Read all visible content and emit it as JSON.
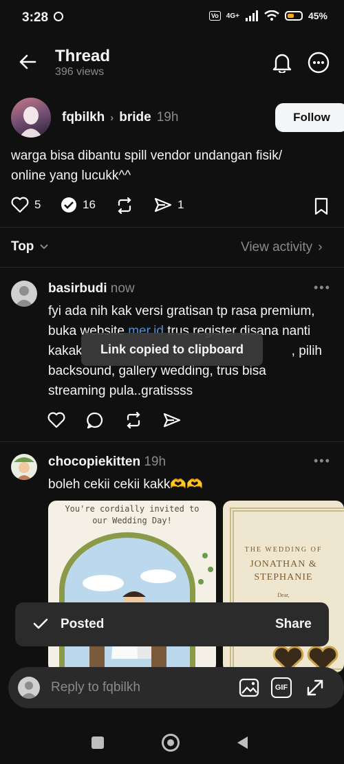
{
  "status_bar": {
    "time": "3:28",
    "battery": "45%",
    "network": "4G+"
  },
  "header": {
    "title": "Thread",
    "views": "396 views"
  },
  "post": {
    "username": "fqbilkh",
    "tag": "bride",
    "time": "19h",
    "follow_label": "Follow",
    "text": "warga bisa dibantu spill vendor undangan fisik/ online yang lucukk^^",
    "likes": "5",
    "reposts": "16",
    "shares": "1"
  },
  "sort": {
    "label": "Top",
    "view_activity": "View activity"
  },
  "replies": [
    {
      "username": "basirbudi",
      "time": "now",
      "line1": "fyi ada nih kak versi gratisan tp rasa premium,",
      "line2_pre": "buka website ",
      "line2_link": "mer.id",
      "line2_post": " trus register disana nanti",
      "line3_pre": "kakak",
      "line3_post": ", pilih",
      "line4": "backsound, gallery wedding, trus bisa",
      "line5": "streaming pula..gratissss"
    },
    {
      "username": "chocopiekitten",
      "time": "19h",
      "text": "boleh cekii cekii kakk🫶🫶",
      "card1_text1": "You're cordially invited to",
      "card1_text2": "our Wedding Day!",
      "card2_small": "THE WEDDING OF",
      "card2_names1": "JONATHAN &",
      "card2_names2": "STEPHANIE",
      "card2_dear": "Dear,"
    }
  ],
  "toast": {
    "text": "Link copied to clipboard"
  },
  "snackbar": {
    "status": "Posted",
    "action": "Share"
  },
  "composer": {
    "placeholder": "Reply to fqbilkh",
    "gif_label": "GIF"
  }
}
